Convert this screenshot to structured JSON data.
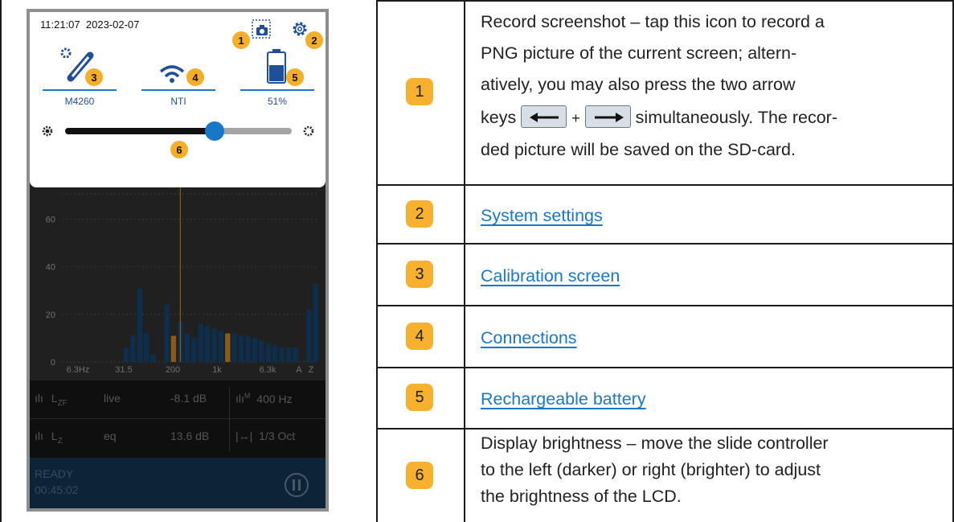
{
  "device": {
    "time": "11:21:07",
    "date": "2023-02-07",
    "tiles": [
      {
        "label": "M4260",
        "icon": "calibration-icon"
      },
      {
        "label": "NTI",
        "icon": "wifi-icon"
      },
      {
        "label": "51%",
        "icon": "battery-icon"
      }
    ],
    "badges": [
      "1",
      "2",
      "3",
      "4",
      "5",
      "6"
    ],
    "brightness_level": 0.66,
    "chart_data": {
      "type": "bar",
      "x_ticks": [
        "6.3Hz",
        "31.5",
        "200",
        "1k",
        "6.3k",
        "A",
        "Z"
      ],
      "y_ticks": [
        "0",
        "20",
        "40",
        "60"
      ],
      "ylim": [
        0,
        70
      ],
      "values": [
        0,
        0,
        0,
        0,
        0,
        0,
        0,
        0,
        0,
        6,
        11,
        31,
        12,
        3,
        0,
        24,
        11,
        17,
        12,
        10,
        16,
        15,
        14,
        13,
        12,
        12,
        11,
        11,
        10,
        9,
        8,
        7,
        6,
        6,
        6,
        0,
        22,
        33
      ]
    },
    "readouts": [
      {
        "name": "L",
        "sub": "ZF",
        "mode": "live",
        "value": "-8.1 dB",
        "extra": "400 Hz",
        "extra_sup": "M"
      },
      {
        "name": "L",
        "sub": "Z",
        "mode": "eq",
        "value": "13.6 dB",
        "extra": "1/3 Oct"
      }
    ],
    "status": "READY",
    "elapsed": "00:45:02"
  },
  "table": {
    "rows": [
      {
        "num": "1",
        "lines": [
          "Record screenshot – tap this icon to record a",
          "PNG picture of the current screen; altern-",
          "atively, you may also press the two arrow"
        ],
        "keys_prefix": "keys",
        "keys_plus": "+",
        "keys_suffix": "simultaneously. The recor-",
        "last_line": "ded picture will be saved on the SD-card."
      },
      {
        "num": "2",
        "link": "System settings"
      },
      {
        "num": "3",
        "link": "Calibration screen"
      },
      {
        "num": "4",
        "link": "Connections"
      },
      {
        "num": "5",
        "link": "Rechargeable battery"
      },
      {
        "num": "6",
        "lines": [
          "Display brightness – move the slide controller",
          "to the left (darker) or right (brighter) to adjust",
          "the brightness of the LCD."
        ]
      }
    ]
  }
}
